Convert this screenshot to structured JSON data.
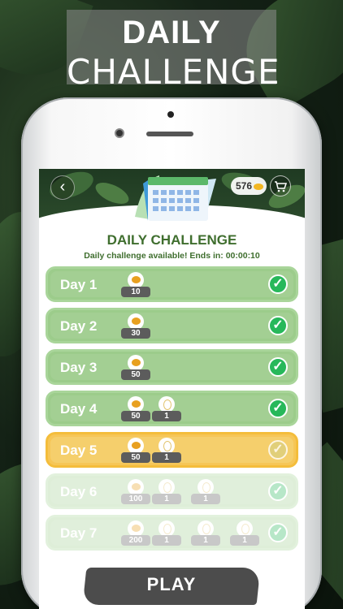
{
  "promo": {
    "line1": "DAILY",
    "line2": "CHALLENGE"
  },
  "header": {
    "back_icon": "chevron-left-icon",
    "coins": "576",
    "cart_icon": "cart-icon"
  },
  "title": "DAILY CHALLENGE",
  "subtitle": "Daily challenge available! Ends in: 00:00:10",
  "days": [
    {
      "label": "Day 1",
      "rewards": [
        "10"
      ],
      "claimed": true
    },
    {
      "label": "Day 2",
      "rewards": [
        "30"
      ],
      "claimed": true
    },
    {
      "label": "Day 3",
      "rewards": [
        "50"
      ],
      "claimed": true
    },
    {
      "label": "Day 4",
      "rewards": [
        "50",
        "1"
      ],
      "claimed": true
    },
    {
      "label": "Day 5",
      "rewards": [
        "50",
        "1"
      ],
      "claimed": false,
      "current": true
    },
    {
      "label": "Day 6",
      "rewards": [
        "100",
        "1",
        "1"
      ],
      "claimed": false
    },
    {
      "label": "Day 7",
      "rewards": [
        "200",
        "1",
        "1",
        "1"
      ],
      "claimed": false
    }
  ],
  "play_label": "PLAY",
  "colors": {
    "green": "#9ccc8b",
    "current": "#f6c657",
    "title": "#3f6e2e",
    "check": "#27b85a"
  }
}
